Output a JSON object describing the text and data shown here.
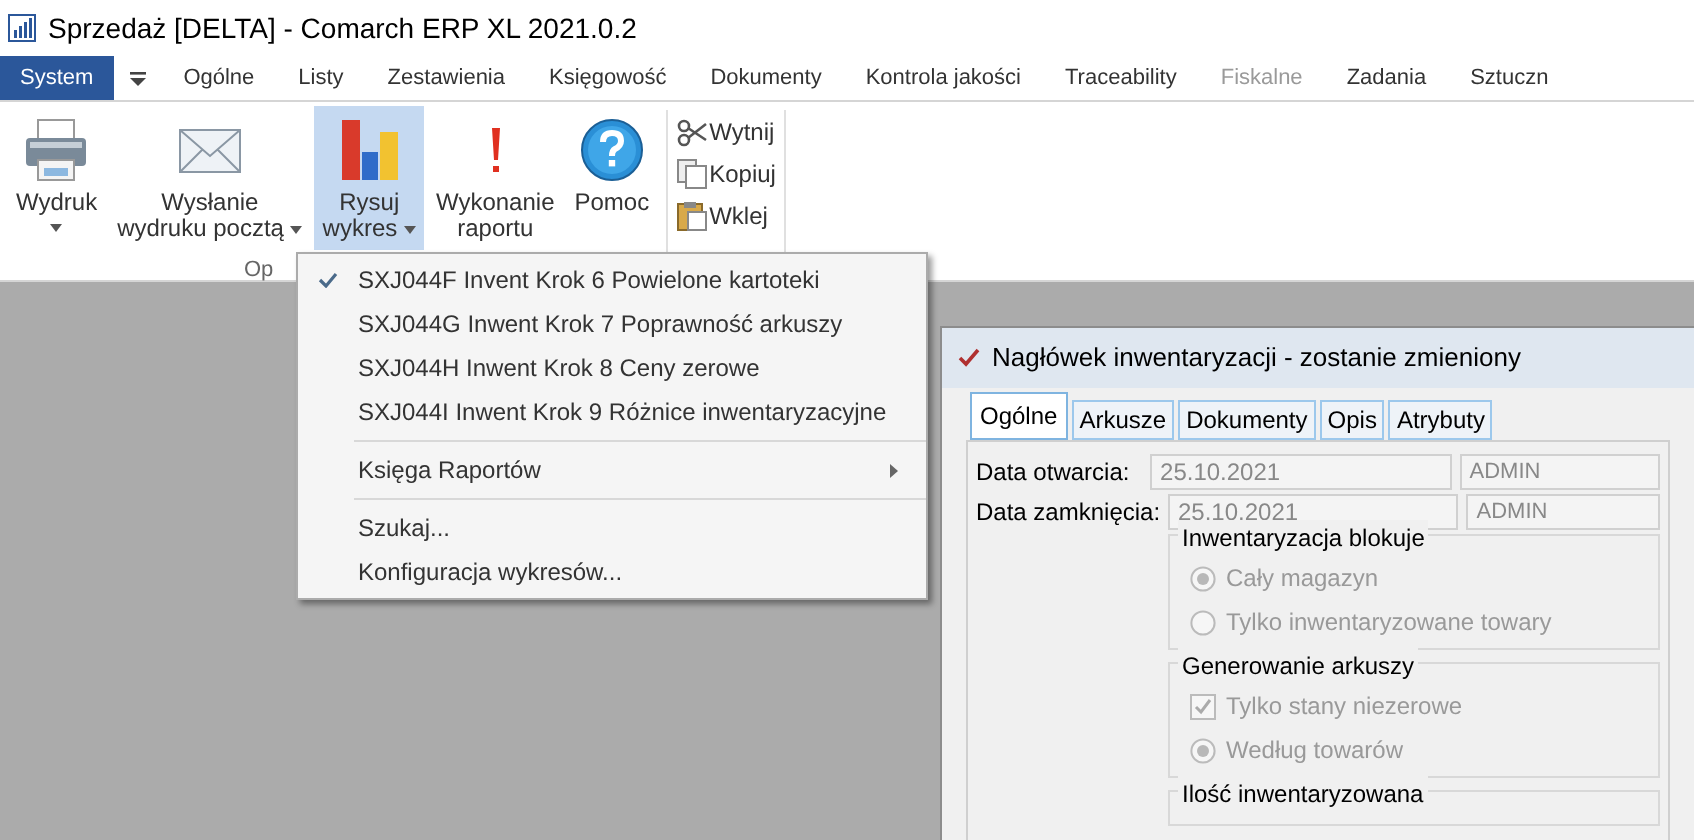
{
  "window": {
    "title": "Sprzedaż [DELTA] - Comarch ERP XL 2021.0.2"
  },
  "ribbon_tabs": [
    {
      "label": "System",
      "selected": true,
      "disabled": false
    },
    {
      "label": "Ogólne",
      "selected": false,
      "disabled": false
    },
    {
      "label": "Listy",
      "selected": false,
      "disabled": false
    },
    {
      "label": "Zestawienia",
      "selected": false,
      "disabled": false
    },
    {
      "label": "Księgowość",
      "selected": false,
      "disabled": false
    },
    {
      "label": "Dokumenty",
      "selected": false,
      "disabled": false
    },
    {
      "label": "Kontrola jakości",
      "selected": false,
      "disabled": false
    },
    {
      "label": "Traceability",
      "selected": false,
      "disabled": false
    },
    {
      "label": "Fiskalne",
      "selected": false,
      "disabled": true
    },
    {
      "label": "Zadania",
      "selected": false,
      "disabled": false
    },
    {
      "label": "Sztuczn",
      "selected": false,
      "disabled": false
    }
  ],
  "ribbon_buttons": [
    {
      "kind": "printer",
      "lines": [
        "Wydruk"
      ],
      "dropdown": true,
      "selected": false
    },
    {
      "kind": "envelope",
      "lines": [
        "Wysłanie",
        "wydruku pocztą"
      ],
      "dropdown": true,
      "selected": false
    },
    {
      "kind": "chart",
      "lines": [
        "Rysuj",
        "wykres"
      ],
      "dropdown": true,
      "selected": true
    },
    {
      "kind": "exclamation",
      "lines": [
        "Wykonanie",
        "raportu"
      ],
      "dropdown": false,
      "selected": false
    },
    {
      "kind": "help",
      "lines": [
        "Pomoc"
      ],
      "dropdown": false,
      "selected": false
    }
  ],
  "clipboard_buttons": [
    {
      "kind": "scissors",
      "label": "Wytnij"
    },
    {
      "kind": "copy",
      "label": "Kopiuj"
    },
    {
      "kind": "paste",
      "label": "Wklej"
    }
  ],
  "group_label": "Op",
  "menu": [
    {
      "kind": "item",
      "label": "SXJ044F Invent Krok 6 Powielone kartoteki",
      "checked": true
    },
    {
      "kind": "item",
      "label": "SXJ044G Inwent Krok 7 Poprawność arkuszy",
      "checked": false
    },
    {
      "kind": "item",
      "label": "SXJ044H Inwent Krok 8 Ceny zerowe",
      "checked": false
    },
    {
      "kind": "item",
      "label": "SXJ044I Inwent Krok 9 Różnice inwentaryzacyjne",
      "checked": false
    },
    {
      "kind": "separator"
    },
    {
      "kind": "submenu",
      "label": "Księga Raportów"
    },
    {
      "kind": "separator"
    },
    {
      "kind": "item",
      "label": "Szukaj...",
      "checked": false
    },
    {
      "kind": "item",
      "label": "Konfiguracja wykresów...",
      "checked": false
    }
  ],
  "dialog": {
    "title": "Nagłówek inwentaryzacji - zostanie zmieniony",
    "tabs": [
      {
        "label": "Ogólne",
        "selected": true
      },
      {
        "label": "Arkusze",
        "selected": false
      },
      {
        "label": "Dokumenty",
        "selected": false
      },
      {
        "label": "Opis",
        "selected": false
      },
      {
        "label": "Atrybuty",
        "selected": false
      }
    ],
    "fields": [
      {
        "label": "Data otwarcia:",
        "value": "25.10.2021",
        "user": "ADMIN"
      },
      {
        "label": "Data zamknięcia:",
        "value": "25.10.2021",
        "user": "ADMIN"
      }
    ],
    "groups": [
      {
        "title": "Inwentaryzacja blokuje",
        "options": [
          {
            "kind": "radio",
            "label": "Cały magazyn",
            "checked": true
          },
          {
            "kind": "radio",
            "label": "Tylko inwentaryzowane towary",
            "checked": false
          }
        ]
      },
      {
        "title": "Generowanie arkuszy",
        "options": [
          {
            "kind": "checkbox",
            "label": "Tylko stany niezerowe",
            "checked": true
          },
          {
            "kind": "radio",
            "label": "Według towarów",
            "checked": true
          }
        ]
      },
      {
        "title": "Ilość inwentaryzowana"
      }
    ]
  }
}
